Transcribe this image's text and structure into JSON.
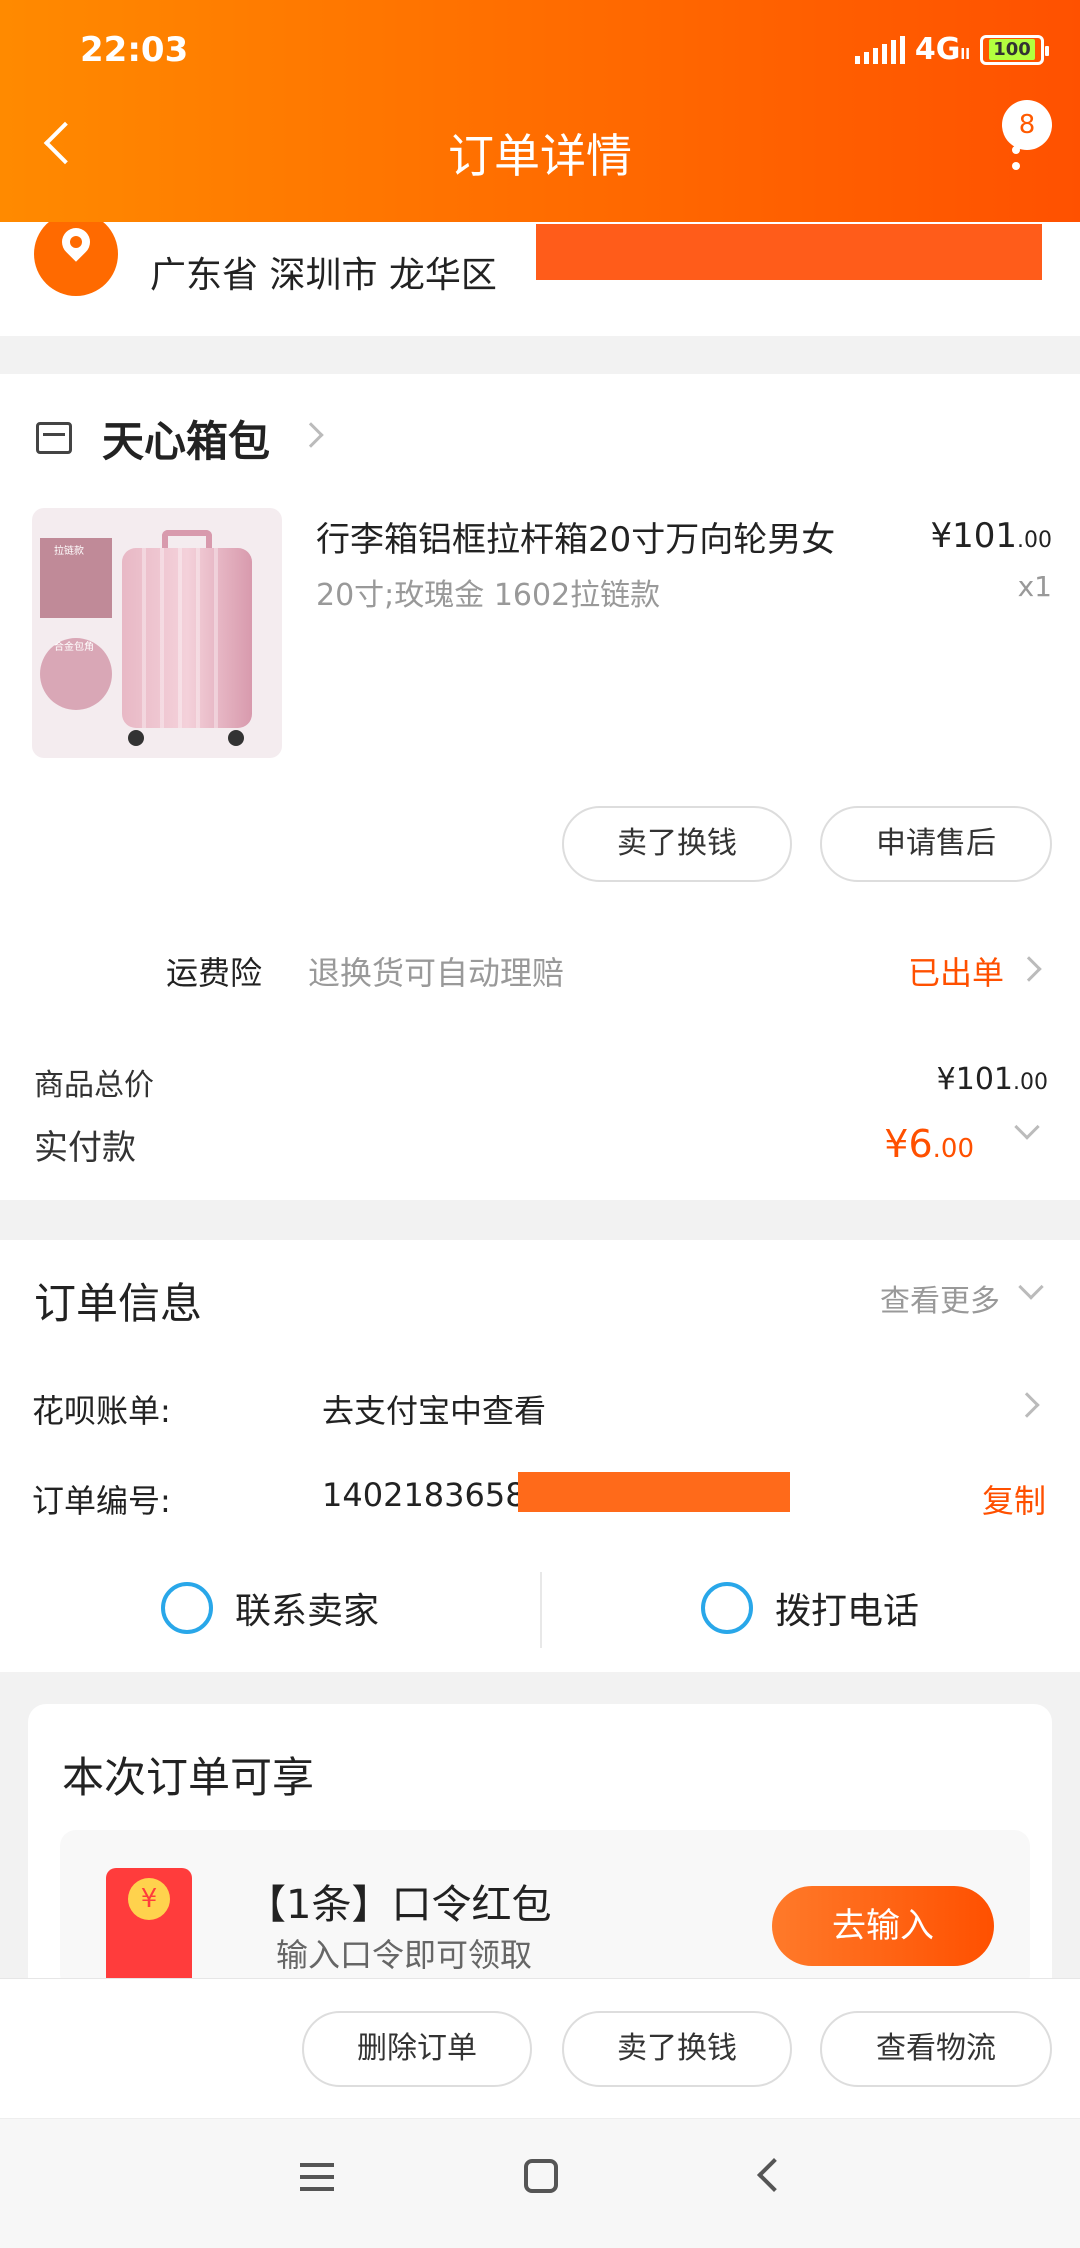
{
  "status": {
    "time": "22:03",
    "network": "4G",
    "network_sub": "ll",
    "battery": "100"
  },
  "header": {
    "title": "订单详情",
    "badge": "8"
  },
  "address": {
    "text": "广东省 深圳市 龙华区"
  },
  "shop": {
    "name": "天心箱包"
  },
  "product": {
    "name": "行李箱铝框拉杆箱20寸万向轮男女",
    "spec": "20寸;玫瑰金  1602拉链款",
    "price_int": "¥101",
    "price_dec": ".00",
    "qty": "x1",
    "img_label1": "拉链款",
    "img_label2": "合金包角"
  },
  "buttons": {
    "sell": "卖了换钱",
    "after_sale": "申请售后"
  },
  "insurance": {
    "label": "运费险",
    "desc": "退换货可自动理赔",
    "status": "已出单"
  },
  "totals": {
    "goods_label": "商品总价",
    "goods_int": "¥101",
    "goods_dec": ".00",
    "paid_label": "实付款",
    "paid_int": "¥6",
    "paid_dec": ".00"
  },
  "order_info": {
    "title": "订单信息",
    "see_more": "查看更多",
    "huabei_label": "花呗账单:",
    "huabei_value": "去支付宝中查看",
    "order_no_label": "订单编号:",
    "order_no_value": "1402183658",
    "copy": "复制",
    "contact_seller": "联系卖家",
    "call": "拨打电话"
  },
  "benefit": {
    "title": "本次订单可享",
    "coupon_title": "【1条】口令红包",
    "coupon_sub": "输入口令即可领取",
    "coupon_btn": "去输入"
  },
  "bottom_actions": {
    "delete": "删除订单",
    "sell": "卖了换钱",
    "logistics": "查看物流"
  },
  "colors": {
    "accent": "#ff5000",
    "header_start": "#ff8a00",
    "header_end": "#ff5100"
  }
}
